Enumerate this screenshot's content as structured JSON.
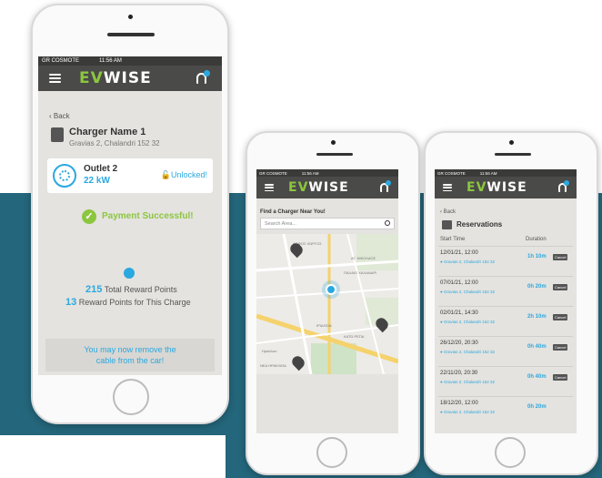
{
  "colors": {
    "teal_band": "#24667b",
    "accent_blue": "#2aa8e0",
    "accent_green": "#8cc63f",
    "appbar": "#4a4a48"
  },
  "statusbar": {
    "carrier": "GR COSMOTE",
    "time": "11:56 AM"
  },
  "app": {
    "logo_ev": "EV",
    "logo_rest": "WISE"
  },
  "phone1": {
    "back_label": "Back",
    "charger_name": "Charger Name 1",
    "address": "Gravias 2, Chalandri 152 32",
    "outlet_name": "Outlet 2",
    "outlet_power": "22 kW",
    "lock_status": "Unlocked!",
    "payment_message": "Payment Successful!",
    "total_points": "215",
    "total_points_label": "Total Reward Points",
    "charge_points": "13",
    "charge_points_label": "Reward Points for This Charge",
    "remove_msg_line1": "You may now remove the",
    "remove_msg_line2": "cable from the car!"
  },
  "phone2": {
    "find_title": "Find a Charger Near You!",
    "search_placeholder": "Search Area...",
    "map_labels": [
      "ΛΟΦΟΣ ΧΩΡΓΟΣ",
      "ΑΓ. ΝΙΚΟΛΑΟΣ",
      "ΠΑΛΑΙΟ ΧΑΛΑΝΔΡΙ",
      "ΙΡΙΔΗΣΙΑ",
      "ΚΑΤΩ ΡΕΠΑ",
      "Ηράκλειο",
      "ΝΕΑ ΗΡΑΚΛΕΙΑ"
    ]
  },
  "phone3": {
    "back_label": "Back",
    "title": "Reservations",
    "col_start": "Start Time",
    "col_duration": "Duration",
    "cancel_label": "Cancel",
    "rows": [
      {
        "date": "12/01/21, 12:00",
        "address": "Gravias 2, Chalandri 152 32",
        "duration": "1h 10m",
        "cancel": true
      },
      {
        "date": "07/01/21, 12:00",
        "address": "Gravias 2, Chalandri 152 32",
        "duration": "0h 20m",
        "cancel": true
      },
      {
        "date": "02/01/21, 14:30",
        "address": "Gravias 2, Chalandri 152 32",
        "duration": "2h 10m",
        "cancel": true
      },
      {
        "date": "26/12/20, 20:30",
        "address": "Gravias 2, Chalandri 152 32",
        "duration": "0h 40m",
        "cancel": true
      },
      {
        "date": "22/11/20, 20:30",
        "address": "Gravias 2, Chalandri 152 32",
        "duration": "0h 40m",
        "cancel": true
      },
      {
        "date": "18/12/20, 12:00",
        "address": "Gravias 2, Chalandri 152 32",
        "duration": "0h 20m",
        "cancel": false
      }
    ]
  }
}
